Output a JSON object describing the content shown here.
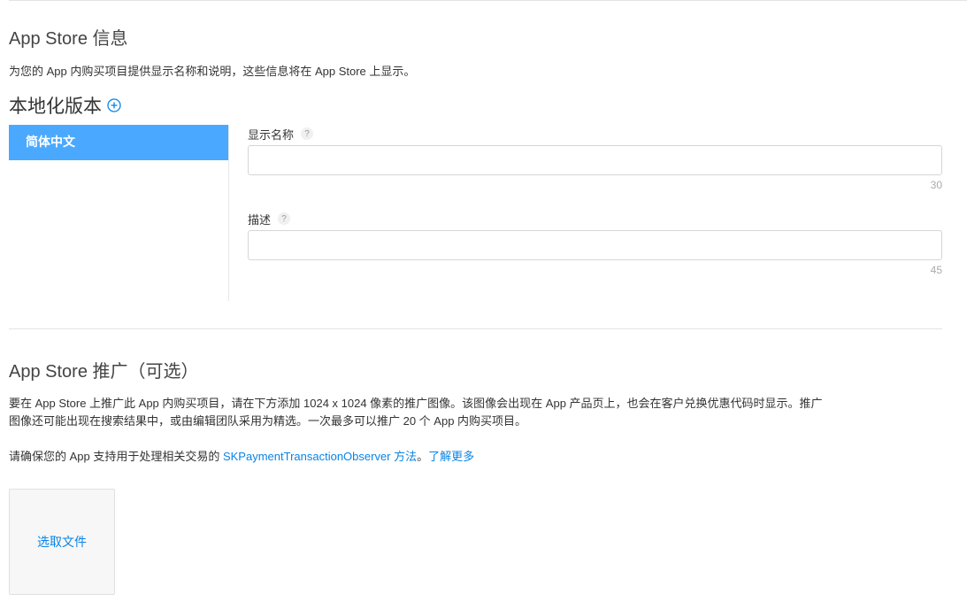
{
  "info": {
    "title": "App Store 信息",
    "description": "为您的 App 内购买项目提供显示名称和说明，这些信息将在 App Store 上显示。"
  },
  "localization": {
    "title": "本地化版本",
    "languages": [
      "简体中文"
    ]
  },
  "fields": {
    "display_name": {
      "label": "显示名称",
      "help": "?",
      "value": "",
      "counter": "30"
    },
    "description": {
      "label": "描述",
      "help": "?",
      "value": "",
      "counter": "45"
    }
  },
  "promotion": {
    "title": "App Store 推广（可选）",
    "paragraph1_line1": "要在 App Store 上推广此 App 内购买项目，请在下方添加 1024 x 1024 像素的推广图像。该图像会出现在 App 产品页上，也会在客户兑换优惠代码时显示。推广",
    "paragraph1_line2": "图像还可能出现在搜索结果中，或由编辑团队采用为精选。一次最多可以推广 20 个 App 内购买项目。",
    "paragraph2_prefix": "请确保您的 App 支持用于处理相关交易的 ",
    "paragraph2_link": "SKPaymentTransactionObserver 方法",
    "paragraph2_sep": "。",
    "learn_more": "了解更多",
    "choose_file": "选取文件"
  },
  "colors": {
    "accent": "#0a84e6",
    "selected": "#4aa9ff"
  }
}
